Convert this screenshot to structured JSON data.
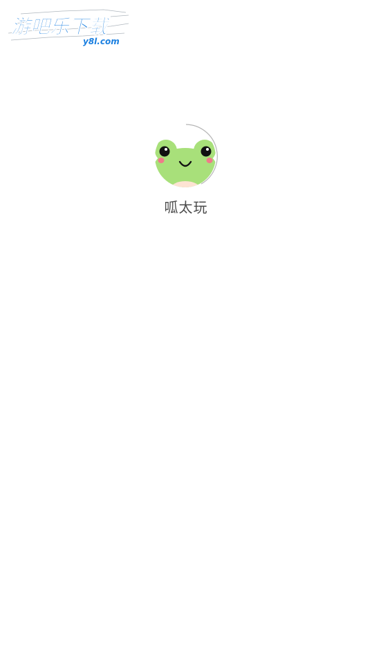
{
  "watermark": {
    "title": "游吧乐下载",
    "domain": "y8l.com",
    "color": "#1a7fe0"
  },
  "splash": {
    "app_name": "呱太玩",
    "icon": "frog-face-icon",
    "loading": "loading-ring"
  },
  "colors": {
    "background": "#ffffff",
    "frog_green": "#a8e07a",
    "cheek": "#f07a8a",
    "belly": "#fde3d3",
    "text": "#4a4a4a",
    "ring": "#b5b5b5"
  }
}
